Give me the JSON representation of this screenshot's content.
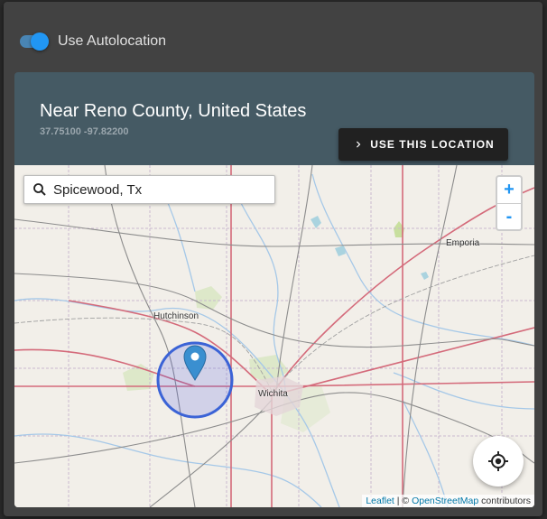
{
  "autolocation": {
    "label": "Use Autolocation",
    "enabled": true
  },
  "location": {
    "title": "Near Reno County, United States",
    "coords": "37.75100 -97.82200",
    "use_button": "USE THIS LOCATION"
  },
  "map": {
    "search_value": "Spicewood, Tx",
    "zoom_in": "+",
    "zoom_out": "-",
    "cities": {
      "emporia": "Emporia",
      "hutchinson": "Hutchinson",
      "wichita": "Wichita"
    },
    "attribution": {
      "leaflet": "Leaflet",
      "separator": " | © ",
      "osm": "OpenStreetMap",
      "suffix": " contributors"
    }
  },
  "colors": {
    "accent": "#2196f3",
    "card": "#455a64",
    "dialog": "#424242"
  }
}
